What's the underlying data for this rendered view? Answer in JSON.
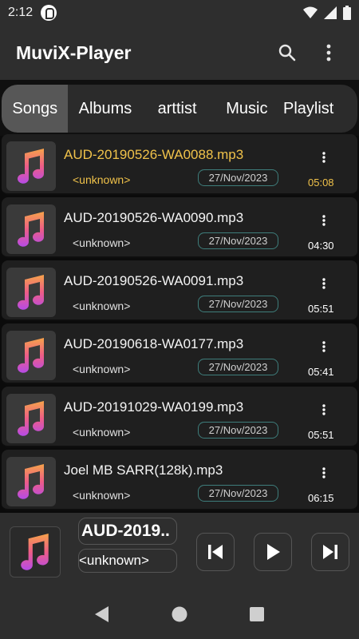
{
  "status_bar": {
    "time": "2:12"
  },
  "app": {
    "title": "MuviX-Player"
  },
  "tabs": [
    {
      "label": "Songs",
      "active": true
    },
    {
      "label": "Albums",
      "active": false
    },
    {
      "label": "arttist",
      "active": false
    },
    {
      "label": "Music",
      "active": false
    },
    {
      "label": "Playlist",
      "active": false
    }
  ],
  "songs": [
    {
      "title": "AUD-20190526-WA0088.mp3",
      "artist": "<unknown>",
      "date": "27/Nov/2023",
      "duration": "05:08",
      "playing": true
    },
    {
      "title": "AUD-20190526-WA0090.mp3",
      "artist": "<unknown>",
      "date": "27/Nov/2023",
      "duration": "04:30",
      "playing": false
    },
    {
      "title": "AUD-20190526-WA0091.mp3",
      "artist": "<unknown>",
      "date": "27/Nov/2023",
      "duration": "05:51",
      "playing": false
    },
    {
      "title": "AUD-20190618-WA0177.mp3",
      "artist": "<unknown>",
      "date": "27/Nov/2023",
      "duration": "05:41",
      "playing": false
    },
    {
      "title": "AUD-20191029-WA0199.mp3",
      "artist": "<unknown>",
      "date": "27/Nov/2023",
      "duration": "05:51",
      "playing": false
    },
    {
      "title": "Joel MB SARR(128k).mp3",
      "artist": "<unknown>",
      "date": "27/Nov/2023",
      "duration": "06:15",
      "playing": false
    }
  ],
  "mini_player": {
    "title": "AUD-2019..",
    "artist": "<unknown>"
  },
  "icons": {
    "search": "search-icon",
    "more": "more-vert-icon",
    "music_note": "music-note-icon",
    "previous": "skip-previous-icon",
    "play": "play-icon",
    "next": "skip-next-icon",
    "back": "nav-back-icon",
    "home": "nav-home-icon",
    "recents": "nav-recents-icon"
  },
  "colors": {
    "playing_accent": "#f0c24a",
    "note_gradient_top": "#f6a34a",
    "note_gradient_bottom": "#b64be6",
    "date_border": "#3e7d7b"
  }
}
